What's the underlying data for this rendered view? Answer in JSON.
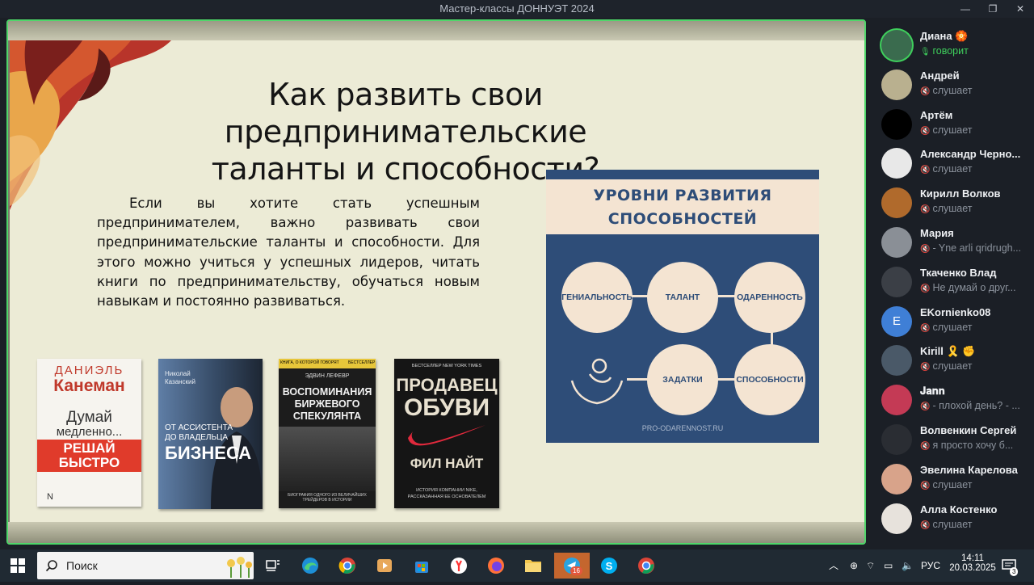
{
  "window": {
    "title": "Мастер-классы ДОННУЭТ 2024",
    "minimize": "—",
    "maximize": "❐",
    "close": "✕"
  },
  "slide": {
    "title_line1": "Как развить свои предпринимательские",
    "title_line2": "таланты и способности?",
    "body": "Если вы хотите стать успешным предпринимателем, важно развивать свои предпринимательские таланты и способности. Для этого можно учиться у успешных лидеров, читать книги по предпринимательству, обучаться новым навыкам и постоянно развиваться."
  },
  "books": [
    {
      "author": "ДАНИЭЛЬ",
      "author2": "Канеман",
      "t1": "Думай",
      "t2": "медленно...",
      "t3": "РЕШАЙ",
      "t4": "БЫСТРО",
      "publisher": "N"
    },
    {
      "author": "Николай",
      "author2": "Казанский",
      "t1": "ОТ АССИСТЕНТА",
      "t2": "ДО ВЛАДЕЛЬЦА",
      "t3": "БИЗНЕСА"
    },
    {
      "topleft": "КНИГА, О КОТОРОЙ ГОВОРЯТ",
      "topright": "БЕСТСЕЛЛЕР",
      "author": "ЭДВИН ЛЕФЕВР",
      "t1": "ВОСПОМИНАНИЯ",
      "t2": "БИРЖЕВОГО",
      "t3": "СПЕКУЛЯНТА",
      "footer": "БИОГРАФИЯ ОДНОГО ИЗ ВЕЛИЧАЙШИХ ТРЕЙДЕРОВ В ИСТОРИИ"
    },
    {
      "top": "БЕСТСЕЛЛЕР NEW YORK TIMES",
      "t1": "ПРОДАВЕЦ",
      "t2": "ОБУВИ",
      "t3": "ФИЛ НАЙТ",
      "footer1": "ИСТОРИЯ КОМПАНИИ NIKE,",
      "footer2": "РАССКАЗАННАЯ ЕЕ ОСНОВАТЕЛЕМ"
    }
  ],
  "infographic": {
    "title1": "УРОВНИ РАЗВИТИЯ",
    "title2": "СПОСОБНОСТЕЙ",
    "c1": "ГЕНИАЛЬНОСТЬ",
    "c2": "ТАЛАНТ",
    "c3": "ОДАРЕННОСТЬ",
    "c4": "ЗАДАТКИ",
    "c5": "СПОСОБНОСТИ",
    "url": "PRO-ODARENNOST.RU"
  },
  "participants": [
    {
      "name": "Диана 🏵️",
      "status": "говорит",
      "avatar_bg": "#3a6b4e",
      "initial": ""
    },
    {
      "name": "Андрей",
      "status": "слушает",
      "avatar_bg": "#b9b08f",
      "initial": ""
    },
    {
      "name": "Артём",
      "status": "слушает",
      "avatar_bg": "#000000",
      "initial": ""
    },
    {
      "name": "Александр Черно...",
      "status": "слушает",
      "avatar_bg": "#e8e8e8",
      "initial": ""
    },
    {
      "name": "Кирилл Волков",
      "status": "слушает",
      "avatar_bg": "#b06a2c",
      "initial": ""
    },
    {
      "name": "Мария",
      "status": "- Yne arli qridrugh...",
      "avatar_bg": "#8a8f96",
      "initial": ""
    },
    {
      "name": "Ткаченко Влад",
      "status": "Не думай о друг...",
      "avatar_bg": "#3b3f46",
      "initial": ""
    },
    {
      "name": "EKornienko08",
      "status": "слушает",
      "avatar_bg": "#3f7fd6",
      "initial": "E"
    },
    {
      "name": "Kirill 🎗️ ✊",
      "status": "слушает",
      "avatar_bg": "#4a5968",
      "initial": ""
    },
    {
      "name": "𝐉𝐚𝐧𝐧",
      "status": "- плохой день? - ...",
      "avatar_bg": "#c43a55",
      "initial": ""
    },
    {
      "name": "Волвенкин Сергей",
      "status": "я просто хочу б...",
      "avatar_bg": "#2a2d33",
      "initial": ""
    },
    {
      "name": "Эвелина Карелова",
      "status": "слушает",
      "avatar_bg": "#d8a38a",
      "initial": ""
    },
    {
      "name": "Алла Костенко",
      "status": "слушает",
      "avatar_bg": "#e7e2dc",
      "initial": ""
    }
  ],
  "taskbar": {
    "search_placeholder": "Поиск",
    "lang": "РУС",
    "time": "14:11",
    "date": "20.03.2025",
    "telegram_badge": "16",
    "notif_count": "3"
  }
}
